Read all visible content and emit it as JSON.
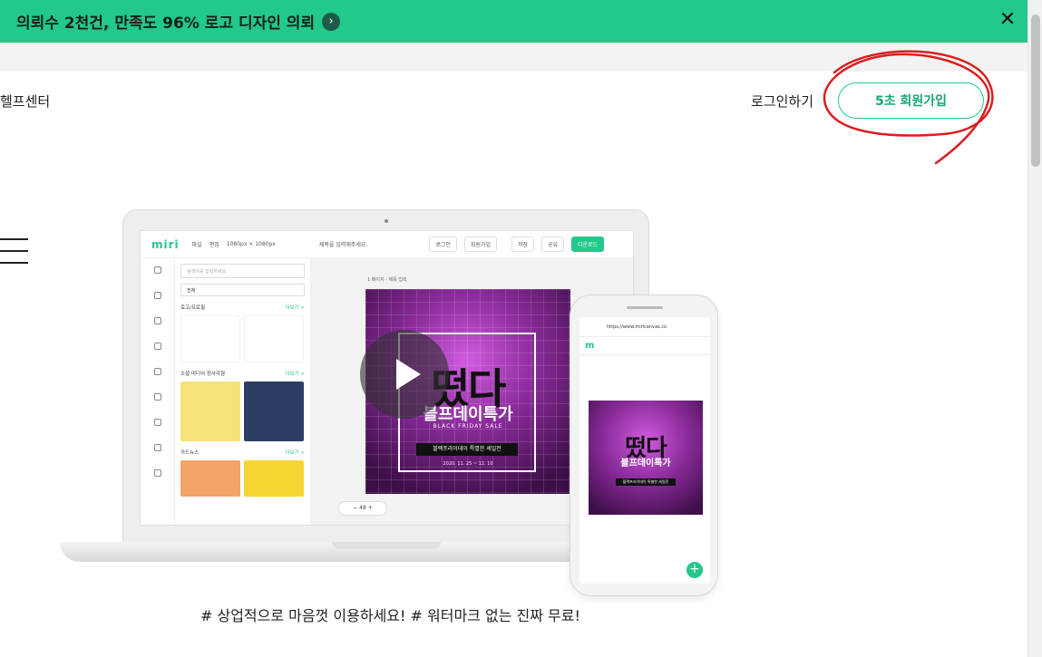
{
  "promo": {
    "text": "의뢰수 2천건, 만족도 96% 로고 디자인 의뢰",
    "arrow": "›",
    "close": "✕",
    "bg_color": "#22c98a"
  },
  "header": {
    "help_center": "헬프센터",
    "login": "로그인하기",
    "signup": "5초 회원가입",
    "accent_color": "#22c98a"
  },
  "hamburger": {
    "icon": "menu-icon"
  },
  "mockup": {
    "editor": {
      "logo": "miri",
      "menu_file": "파일",
      "menu_edit": "편집",
      "size": "1080px × 1080px",
      "title_placeholder": "제목을 입력해주세요.",
      "btn_login": "로그인",
      "btn_join": "회원가입",
      "btn_save": "저장",
      "btn_share": "공유",
      "btn_download": "다운로드",
      "search_placeholder": "검색어를 입력하세요.",
      "filter_all": "전체",
      "section_logo": "로고/프로필",
      "section_social": "소셜 미디어 정사각형",
      "section_card": "카드뉴스",
      "more": "더보기 >",
      "page_label": "1 페이지 - 제목 입력",
      "zoom": "−   48   +"
    },
    "design": {
      "headline": "떴다",
      "subheadline": "블프데이특가",
      "sale_en": "BLACK FRIDAY SALE",
      "pill": "블랙프라이데이 특별한 세일전",
      "date": "2020. 11. 25 ~ 12. 10"
    },
    "phone": {
      "url": "https://www.miricanvas.co",
      "logo": "m",
      "headline": "떴다",
      "subheadline": "블프데이특가",
      "pill": "블랙프라이데이 특별한 세일전",
      "fab": "+"
    }
  },
  "tagline": "# 상업적으로 마음껏 이용하세요! # 워터마크 없는 진짜 무료!"
}
